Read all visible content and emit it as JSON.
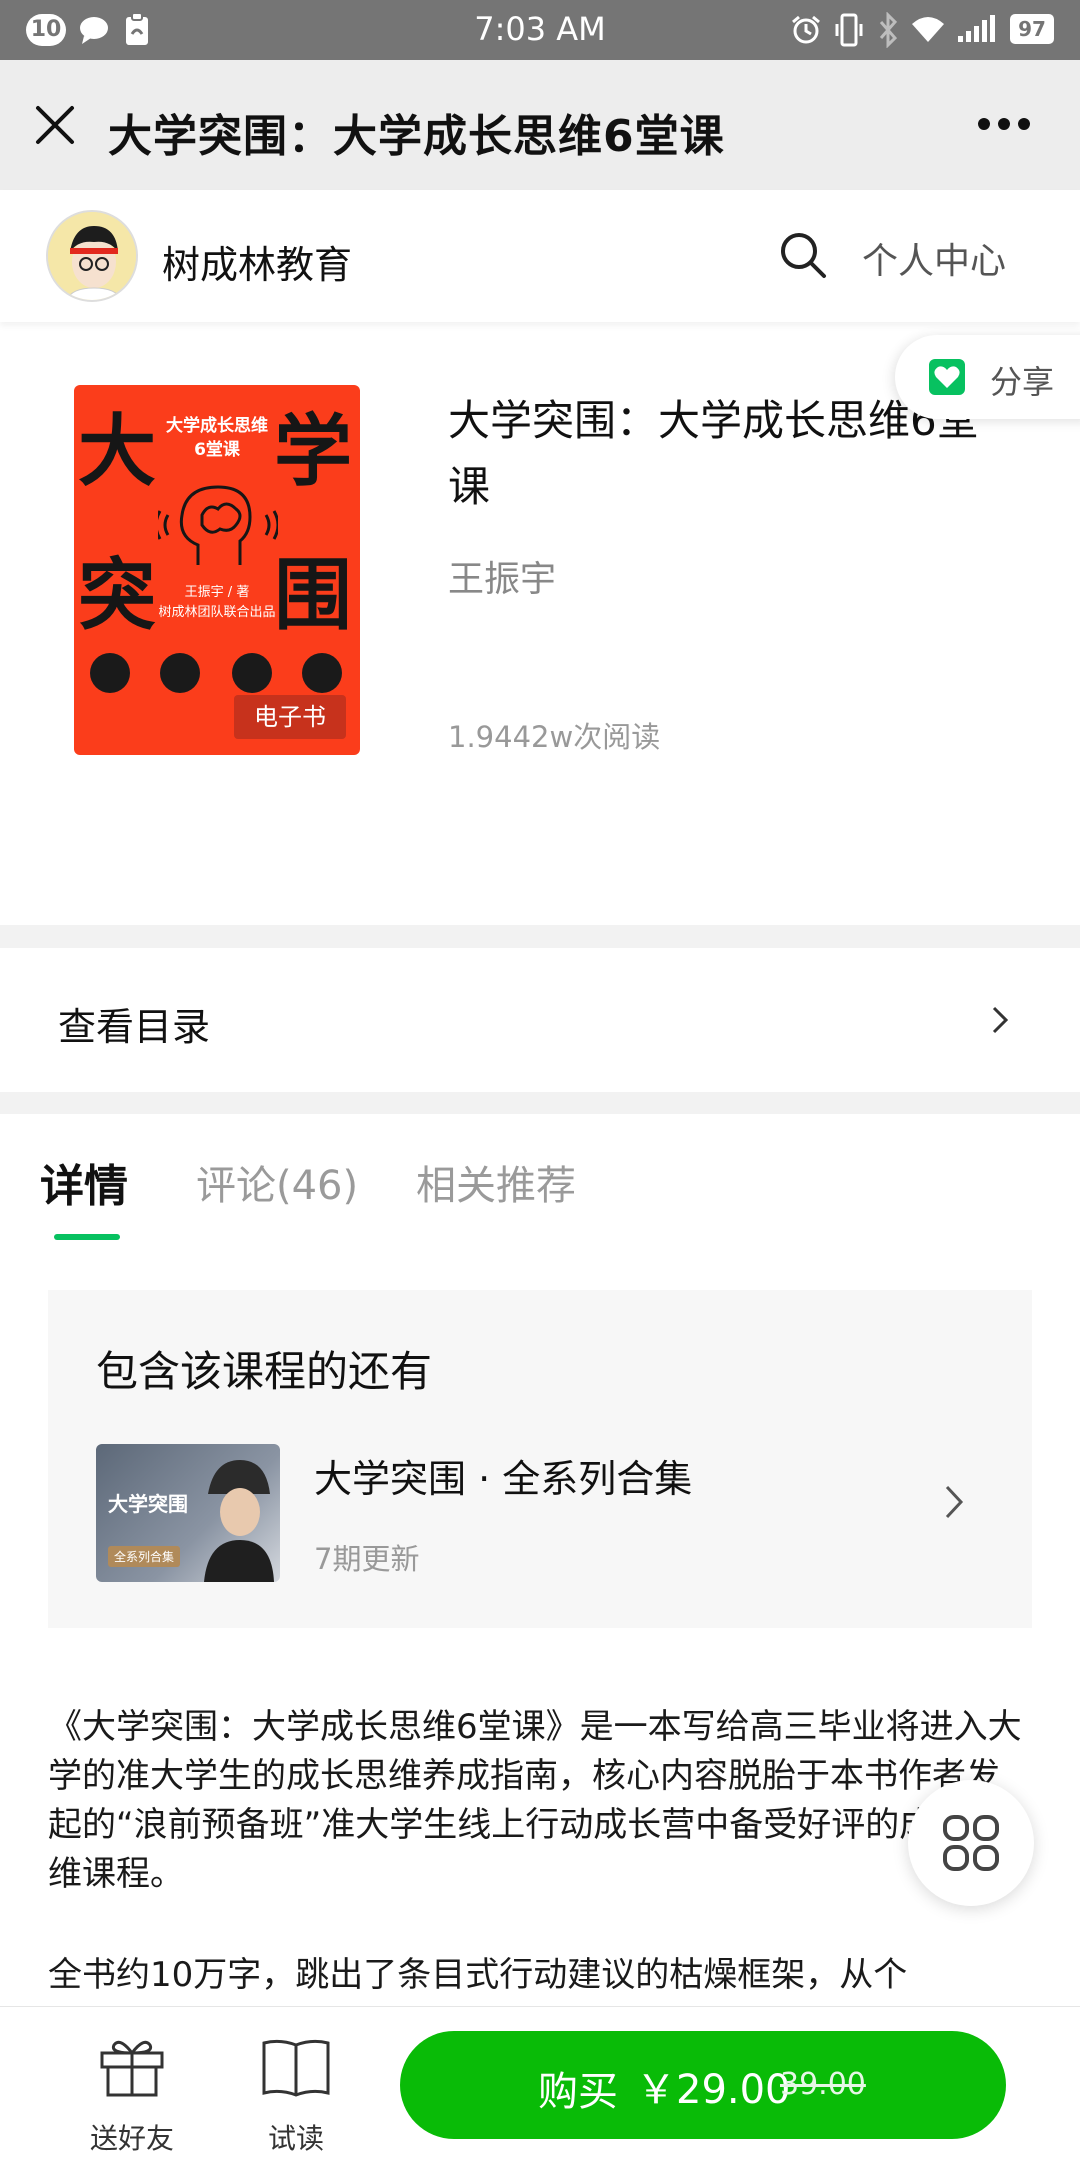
{
  "status_bar": {
    "notification_count": "10",
    "time": "7:03 AM",
    "battery": "97",
    "icons": [
      "chat-icon",
      "clipboard-icon",
      "alarm-icon",
      "vibrate-icon",
      "bluetooth-icon",
      "wifi-icon",
      "signal-icon",
      "battery-icon"
    ]
  },
  "titlebar": {
    "title": "大学突围：大学成长思维6堂课",
    "icons": [
      "close-icon",
      "more-icon"
    ]
  },
  "account": {
    "name": "树成林教育",
    "personal_center": "个人中心",
    "icons": [
      "avatar",
      "search-icon"
    ]
  },
  "book": {
    "title": "大学突围：大学成长思维6堂课",
    "author": "王振宇",
    "reads": "1.9442w次阅读",
    "share_label": "分享",
    "cover": {
      "big_chars": [
        "大",
        "学",
        "突",
        "围"
      ],
      "subtitle_line1": "大学成长思维",
      "subtitle_line2": "6堂课",
      "author_line": "王振宇 / 著",
      "team_line": "树成林团队联合出品",
      "type_tag": "电子书",
      "accent_color": "#fb3d1b"
    }
  },
  "toc": {
    "label": "查看目录"
  },
  "tabs": [
    {
      "label": "详情",
      "active": true
    },
    {
      "label": "评论(46)",
      "active": false
    },
    {
      "label": "相关推荐",
      "active": false
    }
  ],
  "included": {
    "heading": "包含该课程的还有",
    "course_title": "大学突围 · 全系列合集",
    "course_meta": "7期更新",
    "thumb_title": "大学突围",
    "thumb_tag": "全系列合集"
  },
  "description": {
    "para1": "《大学突围：大学成长思维6堂课》是一本写给高三毕业将进入大学的准大学生的成长思维养成指南，核心内容脱胎于本书作者发起的“浪前预备班”准大学生线上行动成长营中备受好评的成长思维课程。",
    "para2": "全书约10万字，跳出了条目式行动建议的枯燥框架，从个"
  },
  "bottom_bar": {
    "gift_label": "送好友",
    "trial_label": "试读",
    "buy_label": "购买",
    "price": "￥29.00",
    "original_price": "39.00",
    "buy_color": "#09bb07"
  }
}
